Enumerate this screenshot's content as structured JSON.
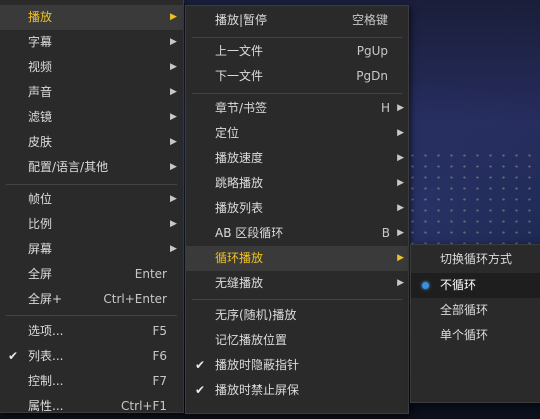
{
  "main_menu": {
    "items": [
      {
        "label": "播放",
        "arrow": "▶",
        "highlighted": true
      },
      {
        "label": "字幕",
        "arrow": "▶"
      },
      {
        "label": "视频",
        "arrow": "▶"
      },
      {
        "label": "声音",
        "arrow": "▶"
      },
      {
        "label": "滤镜",
        "arrow": "▶"
      },
      {
        "label": "皮肤",
        "arrow": "▶"
      },
      {
        "label": "配置/语言/其他",
        "arrow": "▶"
      },
      {
        "label": "帧位",
        "arrow": "▶"
      },
      {
        "label": "比例",
        "arrow": "▶"
      },
      {
        "label": "屏幕",
        "arrow": "▶"
      },
      {
        "label": "全屏",
        "shortcut": "Enter"
      },
      {
        "label": "全屏+",
        "shortcut": "Ctrl+Enter"
      },
      {
        "label": "选项...",
        "shortcut": "F5"
      },
      {
        "label": "列表...",
        "shortcut": "F6",
        "checked": true
      },
      {
        "label": "控制...",
        "shortcut": "F7"
      },
      {
        "label": "属性...",
        "shortcut": "Ctrl+F1"
      }
    ]
  },
  "play_menu": {
    "items": [
      {
        "label": "播放|暂停",
        "shortcut": "空格键"
      },
      {
        "label": "上一文件",
        "shortcut": "PgUp"
      },
      {
        "label": "下一文件",
        "shortcut": "PgDn"
      },
      {
        "label": "章节/书签",
        "shortcut": "H",
        "arrow": "▶"
      },
      {
        "label": "定位",
        "arrow": "▶"
      },
      {
        "label": "播放速度",
        "arrow": "▶"
      },
      {
        "label": "跳略播放",
        "arrow": "▶"
      },
      {
        "label": "播放列表",
        "arrow": "▶"
      },
      {
        "label": "AB 区段循环",
        "shortcut": "B",
        "arrow": "▶"
      },
      {
        "label": "循环播放",
        "arrow": "▶",
        "highlighted": true
      },
      {
        "label": "无缝播放",
        "arrow": "▶"
      },
      {
        "label": "无序(随机)播放"
      },
      {
        "label": "记忆播放位置"
      },
      {
        "label": "播放时隐蔽指针",
        "checked": true
      },
      {
        "label": "播放时禁止屏保",
        "checked": true
      }
    ]
  },
  "loop_menu": {
    "items": [
      {
        "label": "切换循环方式"
      },
      {
        "label": "不循环",
        "selected": true
      },
      {
        "label": "全部循环"
      },
      {
        "label": "单个循环"
      }
    ]
  },
  "icons": {
    "check": "✔",
    "submenu_arrow": "▶",
    "radio": "radio-dot"
  },
  "colors": {
    "menu_bg": "#2a2a2a",
    "highlight_text": "#f0c020",
    "radio_blue": "#3d8fe0"
  }
}
